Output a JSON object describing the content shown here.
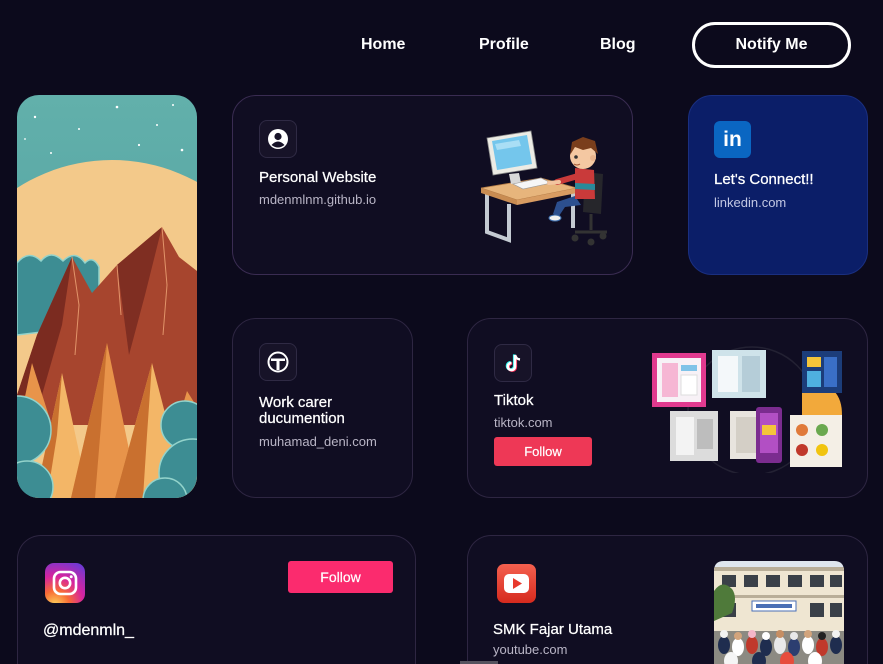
{
  "nav": {
    "items": [
      {
        "label": "Home"
      },
      {
        "label": "Profile"
      },
      {
        "label": "Blog"
      }
    ],
    "cta_label": "Notify Me"
  },
  "colors": {
    "page_background": "#0c0a1c",
    "card_background": "#100d22",
    "linkedin_card": "#0b1e68",
    "linkedin_brand": "#0a66c2",
    "tiktok_follow": "#ee3856",
    "instagram_follow": "#fb2b6e",
    "youtube_red": "#e8392c"
  },
  "cards": {
    "hero": {
      "image": "mountain-sunset-illustration"
    },
    "website": {
      "icon": "user-circle-icon",
      "title": "Personal Website",
      "subtitle": "mdenmlnm.github.io",
      "image": "kid-at-computer-illustration"
    },
    "linkedin": {
      "icon": "linkedin-icon",
      "icon_text": "in",
      "title": "Let's Connect!!",
      "subtitle": "linkedin.com"
    },
    "work": {
      "icon": "work-logo-icon",
      "title": "Work carer ducumention",
      "subtitle": "muhamad_deni.com"
    },
    "tiktok": {
      "icon": "tiktok-icon",
      "title": "Tiktok",
      "subtitle": "tiktok.com",
      "button": "Follow",
      "image": "design-collage"
    },
    "instagram": {
      "icon": "instagram-icon",
      "handle": "@mdenmln_",
      "button": "Follow"
    },
    "youtube": {
      "icon": "youtube-icon",
      "title": "SMK Fajar Utama",
      "subtitle": "youtube.com",
      "image": "school-group-photo"
    }
  }
}
